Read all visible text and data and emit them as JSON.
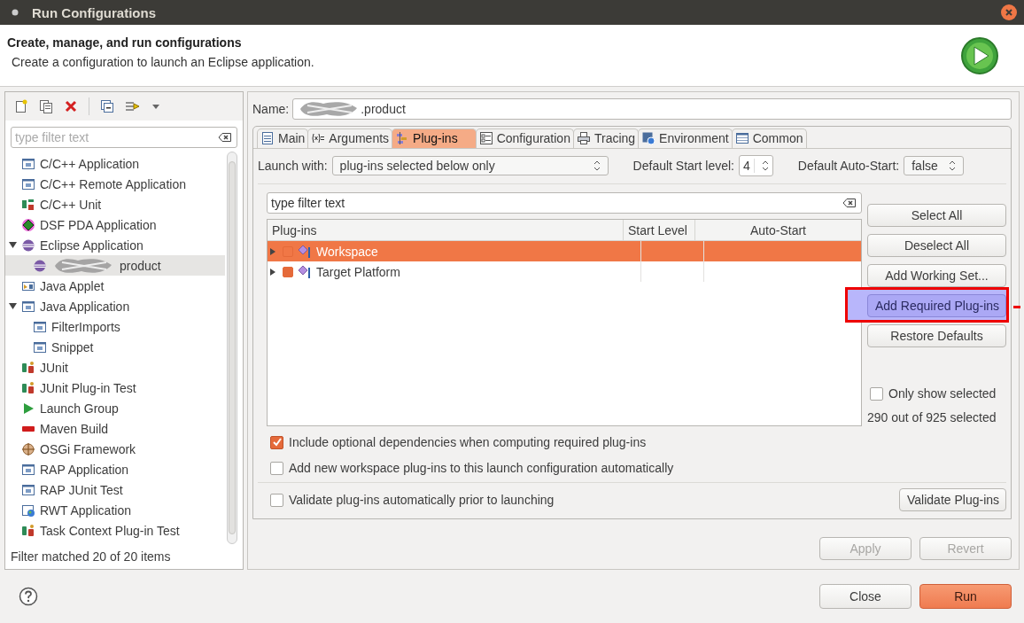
{
  "window": {
    "title": "Run Configurations"
  },
  "header": {
    "title": "Create, manage, and run configurations",
    "description": "Create a configuration to launch an Eclipse application."
  },
  "filter": {
    "placeholder": "type filter text"
  },
  "tree": [
    {
      "label": "C/C++ Application",
      "kind": "window",
      "selected": false
    },
    {
      "label": "C/C++ Remote Application",
      "kind": "window",
      "selected": false
    },
    {
      "label": "C/C++ Unit",
      "kind": "cunit",
      "selected": false
    },
    {
      "label": "DSF PDA Application",
      "kind": "dsf",
      "selected": false
    },
    {
      "label": "Eclipse Application",
      "kind": "sphere",
      "selected": false,
      "expanded": true,
      "children": [
        {
          "label": "product",
          "kind": "sphere",
          "selected": true,
          "redacted": true
        }
      ]
    },
    {
      "label": "Java Applet",
      "kind": "applet",
      "selected": false
    },
    {
      "label": "Java Application",
      "kind": "window",
      "selected": false,
      "expanded": true,
      "children": [
        {
          "label": "FilterImports",
          "kind": "window",
          "selected": false
        },
        {
          "label": "Snippet",
          "kind": "window",
          "selected": false
        }
      ]
    },
    {
      "label": "JUnit",
      "kind": "junit",
      "selected": false
    },
    {
      "label": "JUnit Plug-in Test",
      "kind": "junit",
      "selected": false
    },
    {
      "label": "Launch Group",
      "kind": "play",
      "selected": false
    },
    {
      "label": "Maven Build",
      "kind": "maven",
      "selected": false
    },
    {
      "label": "OSGi Framework",
      "kind": "osgi",
      "selected": false
    },
    {
      "label": "RAP Application",
      "kind": "window",
      "selected": false
    },
    {
      "label": "RAP JUnit Test",
      "kind": "window",
      "selected": false
    },
    {
      "label": "RWT Application",
      "kind": "globe",
      "selected": false
    },
    {
      "label": "Task Context Plug-in Test",
      "kind": "junit",
      "selected": false
    }
  ],
  "filter_status": "Filter matched 20 of 20 items",
  "name_field": {
    "label": "Name:",
    "value": ".product",
    "redacted": true
  },
  "tabs": [
    {
      "label": "Main",
      "kind": "doc",
      "selected": false
    },
    {
      "label": "Arguments",
      "kind": "args",
      "selected": false
    },
    {
      "label": "Plug-ins",
      "kind": "plugin",
      "selected": true
    },
    {
      "label": "Configuration",
      "kind": "list",
      "selected": false
    },
    {
      "label": "Tracing",
      "kind": "printer",
      "selected": false
    },
    {
      "label": "Environment",
      "kind": "env",
      "selected": false
    },
    {
      "label": "Common",
      "kind": "table",
      "selected": false
    }
  ],
  "launch_with": {
    "label": "Launch with:",
    "value": "plug-ins selected below only"
  },
  "start_level": {
    "label": "Default Start level:",
    "value": "4"
  },
  "auto_start": {
    "label": "Default Auto-Start:",
    "value": "false"
  },
  "plugin_filter": {
    "value": "type filter text"
  },
  "table": {
    "columns": [
      "Plug-ins",
      "Start Level",
      "Auto-Start"
    ],
    "rows": [
      {
        "name": "Workspace",
        "checked": false,
        "selected": true,
        "expanded": false
      },
      {
        "name": "Target Platform",
        "checked": true,
        "selected": false,
        "expanded": false
      }
    ]
  },
  "side_buttons": [
    {
      "label": "Select All",
      "highlighted": false
    },
    {
      "label": "Deselect All",
      "highlighted": false
    },
    {
      "label": "Add Working Set...",
      "highlighted": false
    },
    {
      "label": "Add Required Plug-ins",
      "highlighted": true
    },
    {
      "label": "Restore Defaults",
      "highlighted": false
    }
  ],
  "only_show_selected": {
    "label": "Only show selected",
    "checked": false
  },
  "selection_count": "290 out of 925 selected",
  "options": [
    {
      "label": "Include optional dependencies when computing required plug-ins",
      "checked": true
    },
    {
      "label": "Add new workspace plug-ins to this launch configuration automatically",
      "checked": false
    }
  ],
  "validate": {
    "label": "Validate plug-ins automatically prior to launching",
    "checked": false
  },
  "validate_button": "Validate Plug-ins",
  "actions": [
    {
      "label": "Apply",
      "disabled": true
    },
    {
      "label": "Revert",
      "disabled": true
    }
  ],
  "footer_buttons": [
    {
      "label": "Close",
      "primary": false
    },
    {
      "label": "Run",
      "primary": true
    }
  ]
}
